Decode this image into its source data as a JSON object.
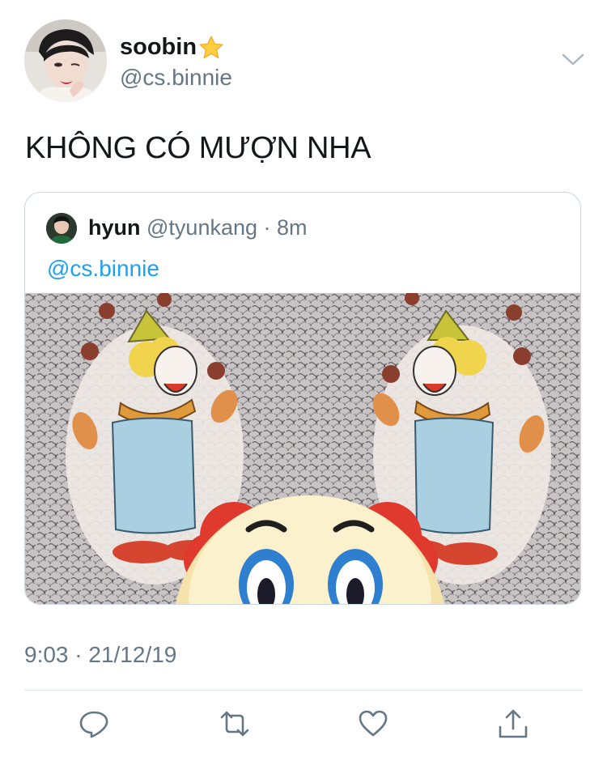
{
  "tweet": {
    "display_name": "soobin",
    "handle": "@cs.binnie",
    "text": "KHÔNG CÓ MƯỢN NHA",
    "timestamp": "9:03 · 21/12/19"
  },
  "quoted_tweet": {
    "display_name": "hyun",
    "handle": "@tyunkang",
    "time": "· 8m",
    "mention": "@cs.binnie"
  },
  "icons": {
    "badge": "star-icon",
    "menu": "chevron-down-icon",
    "reply": "reply-icon",
    "retweet": "retweet-icon",
    "like": "heart-icon",
    "share": "share-icon"
  },
  "colors": {
    "link": "#1da1f2",
    "secondary_text": "#657786",
    "icon": "#657786",
    "border": "#ccd6dd"
  }
}
